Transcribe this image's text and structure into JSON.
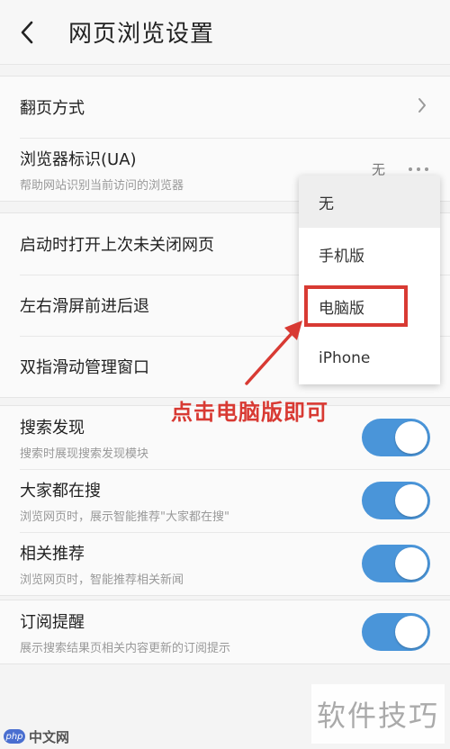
{
  "header": {
    "title": "网页浏览设置"
  },
  "group1": {
    "page_turn": {
      "label": "翻页方式"
    },
    "ua": {
      "label": "浏览器标识(UA)",
      "sub": "帮助网站识别当前访问的浏览器",
      "value": "无"
    }
  },
  "group2": {
    "restore": {
      "label": "启动时打开上次未关闭网页"
    },
    "swipe": {
      "label": "左右滑屏前进后退"
    },
    "two_finger": {
      "label": "双指滑动管理窗口"
    }
  },
  "group3": {
    "search_discover": {
      "label": "搜索发现",
      "sub": "搜索时展现搜索发现模块",
      "enabled": true
    },
    "everyone_searching": {
      "label": "大家都在搜",
      "sub": "浏览网页时，展示智能推荐\"大家都在搜\"",
      "enabled": true
    },
    "related": {
      "label": "相关推荐",
      "sub": "浏览网页时，智能推荐相关新闻",
      "enabled": true
    }
  },
  "group4": {
    "subscribe": {
      "label": "订阅提醒",
      "sub": "展示搜索结果页相关内容更新的订阅提示",
      "enabled": true
    }
  },
  "ua_dropdown": {
    "options": [
      "无",
      "手机版",
      "电脑版",
      "iPhone"
    ],
    "selected": "无",
    "highlighted": "电脑版"
  },
  "annotation": {
    "text": "点击电脑版即可",
    "color": "#d83a33"
  },
  "watermarks": {
    "right": "软件技巧",
    "left_logo": "php",
    "left_site": "中文网"
  },
  "colors": {
    "toggle_on": "#4a95d9",
    "annotation": "#d83a33"
  }
}
